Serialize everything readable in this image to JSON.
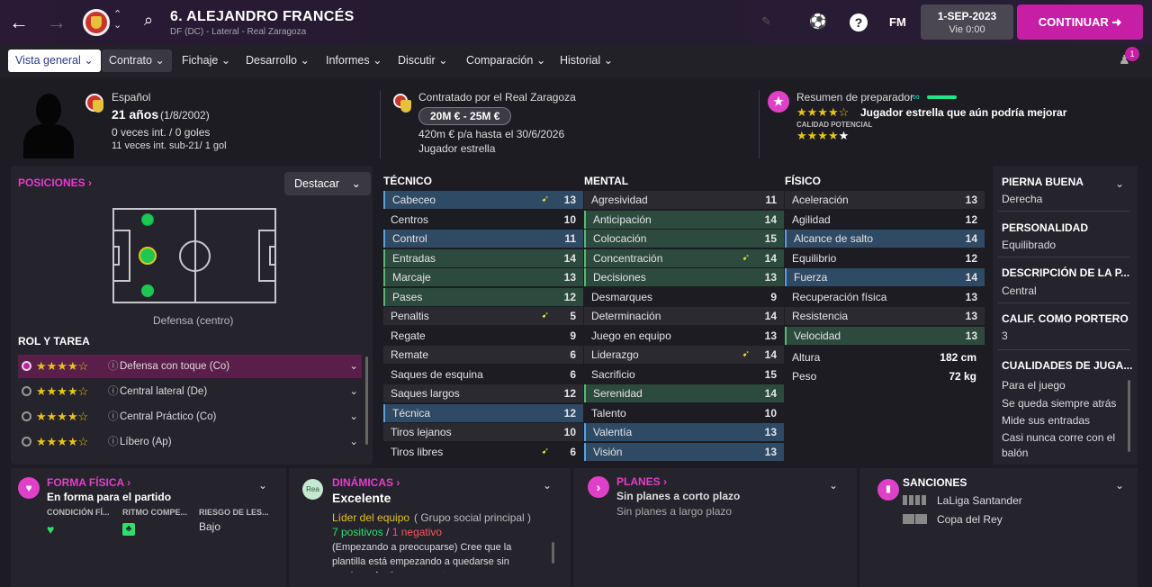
{
  "header": {
    "title": "6. ALEJANDRO FRANCÉS",
    "subtitle": "DF (DC) - Lateral - Real Zaragoza",
    "date": "1-SEP-2023",
    "day": "Vie 0:00",
    "continue_label": "CONTINUAR",
    "fm_label": "FM",
    "help_label": "?"
  },
  "menu": {
    "items": [
      "Vista general",
      "Contrato",
      "Fichaje",
      "Desarrollo",
      "Informes",
      "Discutir",
      "Comparación",
      "Historial"
    ],
    "badge": "1"
  },
  "profile": {
    "nationality": "Español",
    "age": "21 años",
    "dob": "(1/8/2002)",
    "caps": "0 veces int. / 0 goles",
    "u21": "11 veces int. sub-21/ 1 gol"
  },
  "contract": {
    "label": "Contratado por el Real Zaragoza",
    "value": "20M € - 25M €",
    "wage": "420m € p/a hasta el 30/6/2026",
    "status": "Jugador estrella"
  },
  "coach": {
    "label": "Resumen de preparador",
    "summary": "Jugador estrella que aún podría mejorar",
    "potential_label": "CALIDAD POTENCIAL"
  },
  "positions": {
    "title": "POSICIONES",
    "highlight": "Destacar",
    "caption": "Defensa (centro)"
  },
  "roles": {
    "title": "ROL Y TAREA",
    "items": [
      "Defensa con toque (Co)",
      "Central lateral (De)",
      "Central Práctico (Co)",
      "Líbero (Ap)"
    ]
  },
  "technical": {
    "title": "TÉCNICO",
    "rows": [
      [
        "Cabeceo",
        "13"
      ],
      [
        "Centros",
        "10"
      ],
      [
        "Control",
        "11"
      ],
      [
        "Entradas",
        "14"
      ],
      [
        "Marcaje",
        "13"
      ],
      [
        "Pases",
        "12"
      ],
      [
        "Penaltis",
        "5"
      ],
      [
        "Regate",
        "9"
      ],
      [
        "Remate",
        "6"
      ],
      [
        "Saques de esquina",
        "6"
      ],
      [
        "Saques largos",
        "12"
      ],
      [
        "Técnica",
        "12"
      ],
      [
        "Tiros lejanos",
        "10"
      ],
      [
        "Tiros libres",
        "6"
      ]
    ]
  },
  "mental": {
    "title": "MENTAL",
    "rows": [
      [
        "Agresividad",
        "11"
      ],
      [
        "Anticipación",
        "14"
      ],
      [
        "Colocación",
        "15"
      ],
      [
        "Concentración",
        "14"
      ],
      [
        "Decisiones",
        "13"
      ],
      [
        "Desmarques",
        "9"
      ],
      [
        "Determinación",
        "14"
      ],
      [
        "Juego en equipo",
        "13"
      ],
      [
        "Liderazgo",
        "14"
      ],
      [
        "Sacrificio",
        "15"
      ],
      [
        "Serenidad",
        "14"
      ],
      [
        "Talento",
        "10"
      ],
      [
        "Valentía",
        "13"
      ],
      [
        "Visión",
        "13"
      ]
    ]
  },
  "physical": {
    "title": "FÍSICO",
    "rows": [
      [
        "Aceleración",
        "13"
      ],
      [
        "Agilidad",
        "12"
      ],
      [
        "Alcance de salto",
        "14"
      ],
      [
        "Equilibrio",
        "12"
      ],
      [
        "Fuerza",
        "14"
      ],
      [
        "Recuperación física",
        "13"
      ],
      [
        "Resistencia",
        "13"
      ],
      [
        "Velocidad",
        "13"
      ]
    ],
    "height_label": "Altura",
    "height": "182 cm",
    "weight_label": "Peso",
    "weight": "72 kg"
  },
  "side": {
    "foot_h": "PIERNA BUENA",
    "foot": "Derecha",
    "pers_h": "PERSONALIDAD",
    "pers": "Equilibrado",
    "desc_h": "DESCRIPCIÓN DE LA P...",
    "desc": "Central",
    "gk_h": "CALIF. COMO PORTERO",
    "gk": "3",
    "qual_h": "CUALIDADES DE JUGA...",
    "quals": [
      "Para el juego",
      "Se queda siempre atrás",
      "Mide sus entradas",
      "Casi nunca corre con el balón"
    ]
  },
  "fitness": {
    "title": "FORMA FÍSICA",
    "status": "En forma para el partido",
    "c1": "CONDICIÓN FÍ...",
    "c2": "RITMO COMPE...",
    "c3": "RIESGO DE LES...",
    "risk": "Bajo"
  },
  "dynamics": {
    "title": "DINÁMICAS",
    "rea": "Rea",
    "status": "Excelente",
    "leader": "Líder del equipo",
    "group": "( Grupo social principal )",
    "pos": "7 positivos",
    "sep": " / ",
    "neg": "1 negativo",
    "text": "(Empezando a preocuparse) Cree que la plantilla está empezando a quedarse sin muchos efectivos en punto"
  },
  "plans": {
    "title": "PLANES",
    "short": "Sin planes a corto plazo",
    "long": "Sin planes a largo plazo"
  },
  "sanctions": {
    "title": "SANCIONES",
    "l1": "LaLiga Santander",
    "l2": "Copa del Rey"
  }
}
